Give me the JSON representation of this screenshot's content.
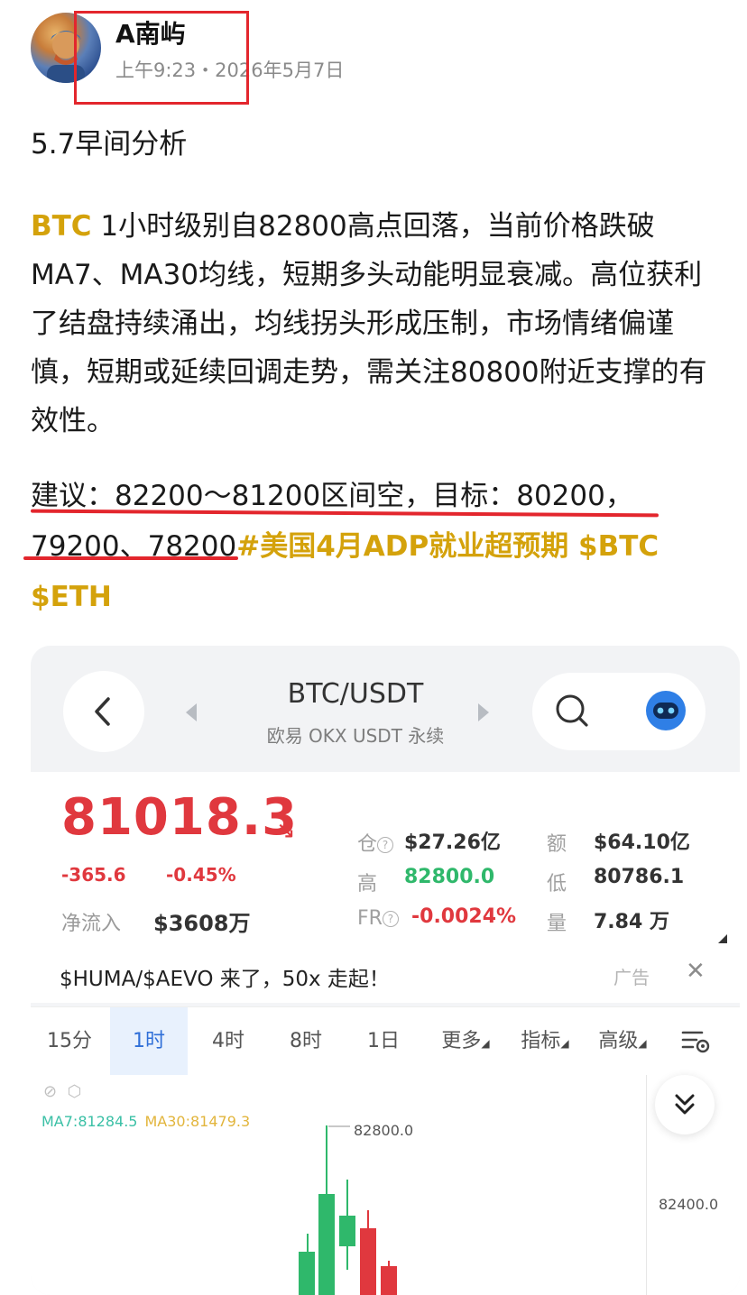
{
  "post": {
    "author": "A南屿",
    "time": "上午9:23",
    "separator": "・",
    "date": "2026年5月7日",
    "title": "5.7早间分析",
    "body_ticker": "BTC",
    "body_text": " 1小时级别自82800高点回落，当前价格跌破MA7、MA30均线，短期多头动能明显衰减。高位获利了结盘持续涌出，均线拐头形成压制，市场情绪偏谨慎，短期或延续回调走势，需关注80800附近支撑的有效性。",
    "suggestion_line1": "建议：82200～81200区间空，目标：80200，",
    "suggestion_line2_plain": "79200、78200",
    "suggestion_hashtag": "#美国4月ADP就业超预期 $BTC $ETH"
  },
  "card": {
    "pair": "BTC/USDT",
    "exchange": "欧易 OKX USDT 永续",
    "price": "81018.3",
    "price_arrow": "↘",
    "change_abs": "-365.6",
    "change_pct": "-0.45%",
    "inflow_label": "净流入",
    "inflow_value": "$3608万",
    "stats": {
      "oi_label": "仓",
      "oi_value": "$27.26亿",
      "turnover_label": "额",
      "turnover_value": "$64.10亿",
      "high_label": "高",
      "high_value": "82800.0",
      "low_label": "低",
      "low_value": "80786.1",
      "fr_label": "FR",
      "fr_value": "-0.0024%",
      "vol_label": "量",
      "vol_value": "7.84 万"
    },
    "ad_text": "$HUMA/$AEVO 来了，50x 走起！",
    "ad_tag": "广告",
    "tabs": [
      "15分",
      "1时",
      "4时",
      "8时",
      "1日",
      "更多",
      "指标",
      "高级"
    ],
    "active_tab": "1时",
    "ma7": "MA7:81284.5",
    "ma30": "MA30:81479.3",
    "high_marker": "82800.0",
    "axis_label": "82400.0"
  },
  "colors": {
    "red": "#e0383e",
    "green": "#2fb86b",
    "gold": "#d4a20b",
    "accent_blue": "#2f6fd8"
  },
  "icons": [
    "back-icon",
    "search-icon",
    "bot-avatar-icon",
    "close-icon",
    "chart-settings-icon",
    "double-chevron-down-icon"
  ]
}
